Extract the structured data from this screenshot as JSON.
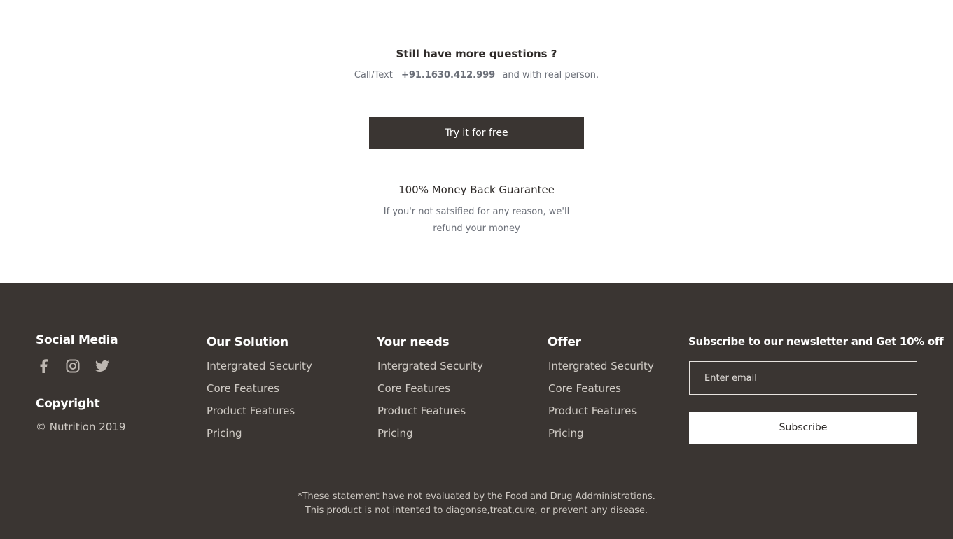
{
  "questions": {
    "title": "Still have more questions ?",
    "prefix": "Call/Text",
    "phone": "+91.1630.412.999",
    "suffix": "and with real person.",
    "cta_label": "Try it for free"
  },
  "guarantee": {
    "title": "100% Money Back Guarantee",
    "text": "If you'r not satsified for any reason, we'll refund your money"
  },
  "footer": {
    "social_title": "Social Media",
    "social_icons": [
      "facebook-icon",
      "instagram-icon",
      "twitter-icon"
    ],
    "copyright_title": "Copyright",
    "copyright_text": "© Nutrition 2019",
    "columns": [
      {
        "title": "Our Solution",
        "links": [
          "Intergrated Security",
          "Core Features",
          "Product Features",
          "Pricing"
        ]
      },
      {
        "title": "Your needs",
        "links": [
          "Intergrated Security",
          "Core Features",
          "Product Features",
          "Pricing"
        ]
      },
      {
        "title": "Offer",
        "links": [
          "Intergrated Security",
          "Core Features",
          "Product Features",
          "Pricing"
        ]
      }
    ],
    "newsletter": {
      "title": "Subscribe to our newsletter and Get 10% off",
      "placeholder": "Enter email",
      "button_label": "Subscribe"
    },
    "disclaimer_line1": "*These statement have not evaluated by the Food and Drug Addministrations.",
    "disclaimer_line2": "This product is not intented to diagonse,treat,cure, or prevent any disease."
  },
  "colors": {
    "footer_bg": "#3a3532",
    "button_dark": "#3a3532",
    "muted_text": "#6b6f78"
  }
}
